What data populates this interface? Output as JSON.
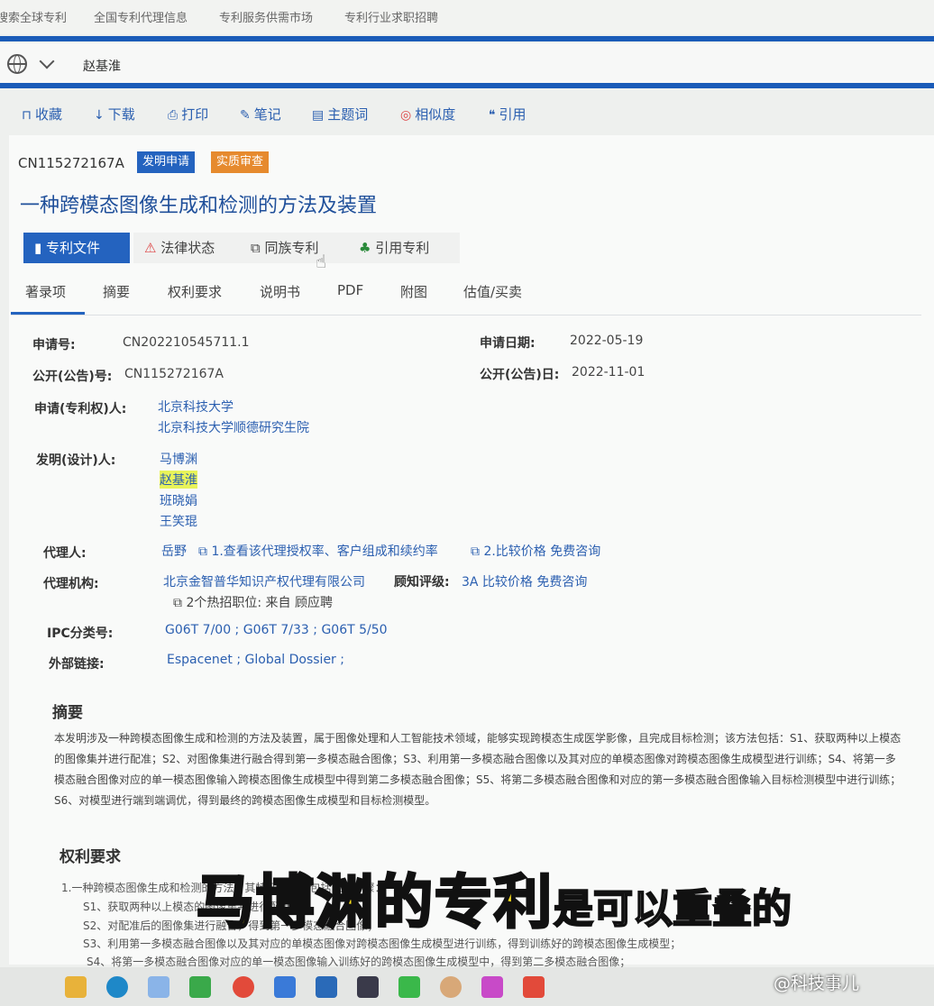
{
  "topnav": {
    "items": [
      "搜索全球专利",
      "全国专利代理信息",
      "专利服务供需市场",
      "专利行业求职招聘"
    ]
  },
  "search": {
    "query": "赵基淮"
  },
  "toolbar": {
    "items": [
      "收藏",
      "下载",
      "打印",
      "笔记",
      "主题词",
      "相似度",
      "引用"
    ]
  },
  "patent": {
    "pub_no": "CN115272167A",
    "badges": [
      "发明申请",
      "实质审查"
    ],
    "title": "一种跨模态图像生成和检测的方法及装置"
  },
  "primary_tabs": [
    "专利文件",
    "法律状态",
    "同族专利",
    "引用专利"
  ],
  "secondary_tabs": [
    "著录项",
    "摘要",
    "权利要求",
    "说明书",
    "PDF",
    "附图",
    "估值/买卖"
  ],
  "biblio": {
    "app_no_label": "申请号:",
    "app_no": "CN202210545711.1",
    "app_date_label": "申请日期:",
    "app_date": "2022-05-19",
    "pub_no_label": "公开(公告)号:",
    "pub_no": "CN115272167A",
    "pub_date_label": "公开(公告)日:",
    "pub_date": "2022-11-01",
    "applicant_label": "申请(专利权)人:",
    "applicants": [
      "北京科技大学",
      "北京科技大学顺德研究生院"
    ],
    "inventor_label": "发明(设计)人:",
    "inventors": [
      "马博渊",
      "赵基淮",
      "班晓娟",
      "王笑琨"
    ],
    "agent_label": "代理人:",
    "agent": "岳野",
    "agent_link1": "1.查看该代理授权率、客户组成和续约率",
    "agent_link2": "2.比较价格 免费咨询",
    "agency_label": "代理机构:",
    "agency": "北京金智普华知识产权代理有限公司",
    "rating_label": "顾知评级:",
    "rating": "3A 比较价格 免费咨询",
    "jobs": "2个热招职位: 来自 顾应聘",
    "ipc_label": "IPC分类号:",
    "ipc": "G06T 7/00 ; G06T 7/33 ; G06T 5/50",
    "ext_label": "外部链接:",
    "ext": "Espacenet ; Global Dossier ;"
  },
  "abstract": {
    "heading": "摘要",
    "text": "本发明涉及一种跨模态图像生成和检测的方法及装置，属于图像处理和人工智能技术领域，能够实现跨模态生成医学影像，且完成目标检测；该方法包括：S1、获取两种以上模态的图像集并进行配准；S2、对图像集进行融合得到第一多模态融合图像；S3、利用第一多模态融合图像以及其对应的单模态图像对跨模态图像生成模型进行训练；S4、将第一多模态融合图像对应的单一模态图像输入跨模态图像生成模型中得到第二多模态融合图像；S5、将第二多模态融合图像和对应的第一多模态融合图像输入目标检测模型中进行训练；S6、对模型进行端到端调优，得到最终的跨模态图像生成模型和目标检测模型。"
  },
  "claims": {
    "heading": "权利要求",
    "lines": [
      "1.一种跨模态图像生成和检测的方法，其特征在于，包括以下步骤：",
      "S1、获取两种以上模态的图像集并进行配准；",
      "S2、对配准后的图像集进行融合，得到第一多模态融合图像；",
      "S3、利用第一多模态融合图像以及其对应的单模态图像对跨模态图像生成模型进行训练，得到训练好的跨模态图像生成模型；",
      "S4、将第一多模态融合图像对应的单一模态图像输入训练好的跨模态图像生成模型中，得到第二多模态融合图像；"
    ]
  },
  "caption": {
    "highlight": "马博渊的专利",
    "rest": "是可以重叠的"
  },
  "watermark": "@科技事儿"
}
